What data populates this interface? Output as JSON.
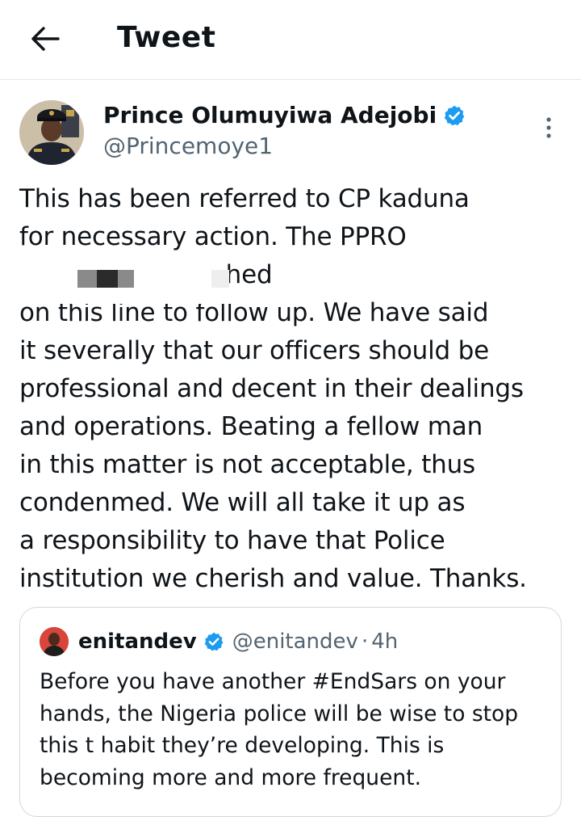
{
  "header": {
    "title": "Tweet",
    "back_icon": "arrow-left-icon"
  },
  "tweet": {
    "author_name": "Prince Olumuyiwa Adejobi",
    "author_handle": "@Princemoye1",
    "verified_icon": "verified-badge-icon",
    "more_icon": "more-vertical-icon",
    "text": "This has been referred to CP kaduna\nfor necessary action. The PPRO\n                          66 could be reached\non this line to follow up. We have said\nit severally that our officers should be\nprofessional and decent in their dealings\nand operations. Beating a fellow man\nin this matter is not acceptable, thus\ncondenmed. We will all take it up as\na responsibility to have that Police\ninstitution we cherish and value. Thanks."
  },
  "quoted_tweet": {
    "author_name": "enitandev",
    "author_handle": "@enitandev",
    "separator": "·",
    "time": "4h",
    "text": "Before you have another #EndSars on your\nhands, the Nigeria police will be wise to stop\nthis t habit they’re developing. This is\nbecoming more and more frequent."
  },
  "colors": {
    "text": "#0f1419",
    "secondary_text": "#536471",
    "verified_blue": "#1d9bf0",
    "border": "#cfd9de"
  }
}
